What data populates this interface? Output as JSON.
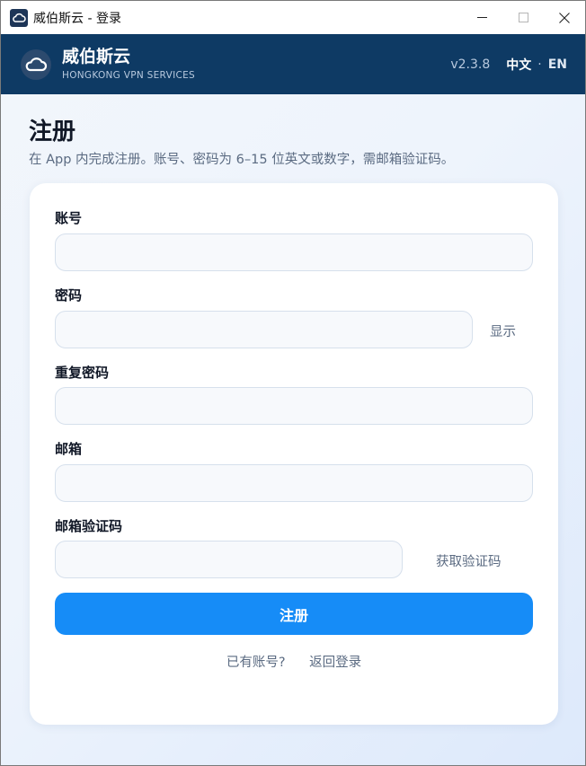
{
  "window": {
    "title": "威伯斯云 - 登录"
  },
  "header": {
    "brand_name": "威伯斯云",
    "brand_sub": "HONGKONG VPN SERVICES",
    "version": "v2.3.8",
    "lang_zh": "中文",
    "lang_sep": "·",
    "lang_en": "EN"
  },
  "page": {
    "title": "注册",
    "description": "在 App 内完成注册。账号、密码为 6–15 位英文或数字，需邮箱验证码。"
  },
  "form": {
    "account_label": "账号",
    "account_value": "",
    "password_label": "密码",
    "password_value": "",
    "show_label": "显示",
    "repeat_label": "重复密码",
    "repeat_value": "",
    "email_label": "邮箱",
    "email_value": "",
    "code_label": "邮箱验证码",
    "code_value": "",
    "get_code_label": "获取验证码",
    "submit_label": "注册",
    "have_account": "已有账号?",
    "back_login": "返回登录"
  },
  "colors": {
    "header_bg": "#0e3a64",
    "accent": "#168cf7",
    "text_muted": "#5b6b82"
  },
  "icons": {
    "app": "cloud-icon",
    "logo": "cloud-icon",
    "minimize": "minimize-icon",
    "maximize": "maximize-icon",
    "close": "close-icon"
  }
}
